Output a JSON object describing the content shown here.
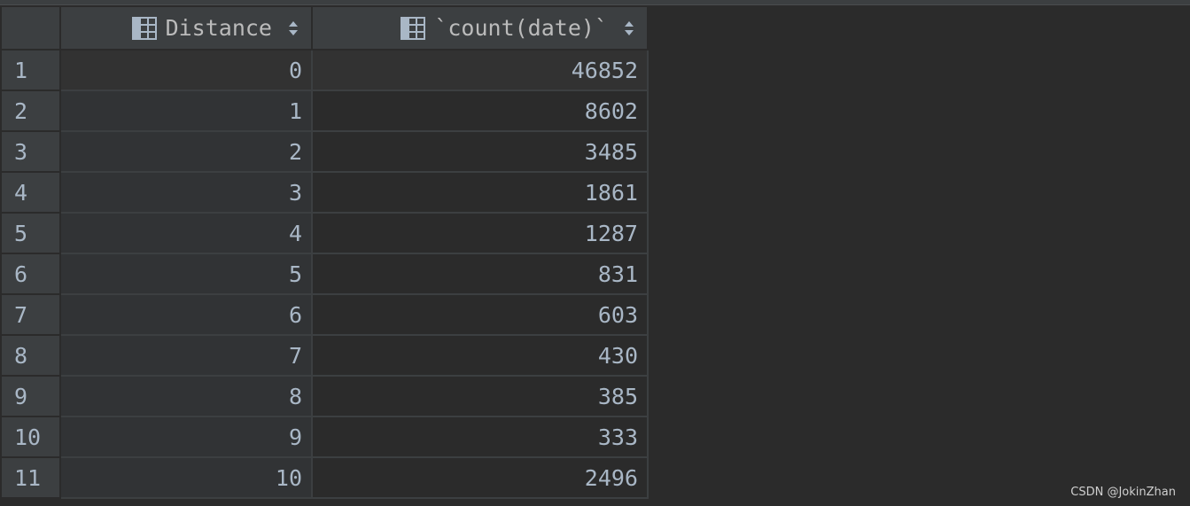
{
  "columns": [
    {
      "label": "Distance",
      "icon": "table-column-icon",
      "sort_icon": "sort-arrows-icon"
    },
    {
      "label": "`count(date)`",
      "icon": "table-column-icon",
      "sort_icon": "sort-arrows-icon"
    }
  ],
  "rows": [
    {
      "num": "1",
      "distance": "0",
      "count": "46852"
    },
    {
      "num": "2",
      "distance": "1",
      "count": "8602"
    },
    {
      "num": "3",
      "distance": "2",
      "count": "3485"
    },
    {
      "num": "4",
      "distance": "3",
      "count": "1861"
    },
    {
      "num": "5",
      "distance": "4",
      "count": "1287"
    },
    {
      "num": "6",
      "distance": "5",
      "count": "831"
    },
    {
      "num": "7",
      "distance": "6",
      "count": "603"
    },
    {
      "num": "8",
      "distance": "7",
      "count": "430"
    },
    {
      "num": "9",
      "distance": "8",
      "count": "385"
    },
    {
      "num": "10",
      "distance": "9",
      "count": "333"
    },
    {
      "num": "11",
      "distance": "10",
      "count": "2496"
    }
  ],
  "watermark": "CSDN @JokinZhan",
  "colors": {
    "background": "#2b2b2b",
    "header_bg": "#3c3f41",
    "text": "#a9b7c6"
  }
}
